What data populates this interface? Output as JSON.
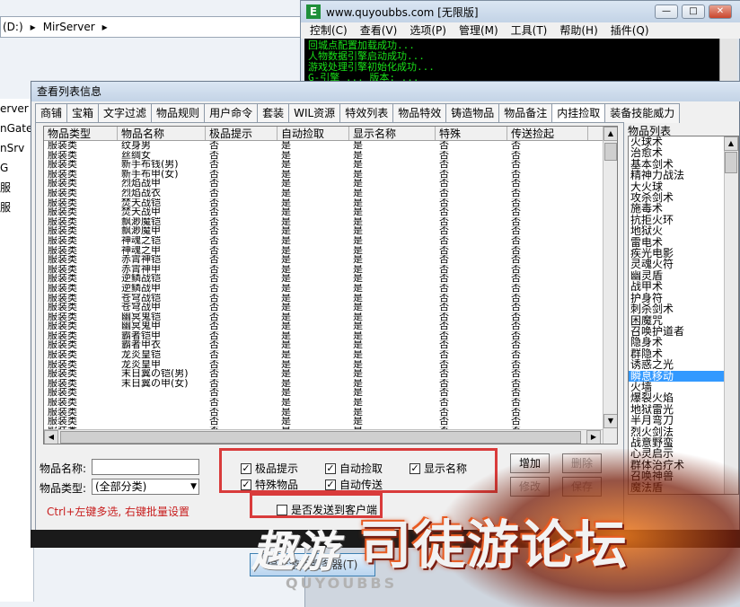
{
  "explorer": {
    "address": [
      "(D:)",
      "MirServer"
    ],
    "left_items": [
      "erver",
      "nGate",
      "nSrv",
      "G",
      "服",
      "服",
      "",
      "",
      "",
      "",
      "",
      "",
      "",
      "",
      "",
      ""
    ]
  },
  "console": {
    "title": "www.quyoubbs.com [无限版]",
    "logo": "E",
    "menu": [
      "控制(C)",
      "查看(V)",
      "选项(P)",
      "管理(M)",
      "工具(T)",
      "帮助(H)",
      "插件(Q)"
    ],
    "log": [
      "回城点配置加载成功...",
      "人物数据引擎启动成功...",
      "游戏处理引擎初始化成功...",
      "G-引擎 ... 版本: ..."
    ]
  },
  "dialog": {
    "title": "查看列表信息",
    "tabs": [
      "商铺",
      "宝箱",
      "文字过滤",
      "物品规则",
      "用户命令",
      "套装",
      "WIL资源",
      "特效列表",
      "物品特效",
      "铸造物品",
      "物品备注",
      "内挂捡取",
      "装备技能威力"
    ],
    "active_tab": 11,
    "columns": [
      "物品类型",
      "物品名称",
      "极品提示",
      "自动捡取",
      "显示名称",
      "特殊",
      "传送捡起"
    ],
    "rows": [
      [
        "服装类",
        "纹身男",
        "否",
        "是",
        "是",
        "否",
        "否"
      ],
      [
        "服装类",
        "丝绸女",
        "否",
        "是",
        "是",
        "否",
        "否"
      ],
      [
        "服装类",
        "新手布钱(男)",
        "否",
        "是",
        "是",
        "否",
        "否"
      ],
      [
        "服装类",
        "新手布甲(女)",
        "否",
        "是",
        "是",
        "否",
        "否"
      ],
      [
        "服装类",
        "烈焰战甲",
        "否",
        "是",
        "是",
        "否",
        "否"
      ],
      [
        "服装类",
        "烈焰战衣",
        "否",
        "是",
        "是",
        "否",
        "否"
      ],
      [
        "服装类",
        "焚天战铠",
        "否",
        "是",
        "是",
        "否",
        "否"
      ],
      [
        "服装类",
        "焚天战甲",
        "否",
        "是",
        "是",
        "否",
        "否"
      ],
      [
        "服装类",
        "飘渺魔铠",
        "否",
        "是",
        "是",
        "否",
        "否"
      ],
      [
        "服装类",
        "飘渺魔甲",
        "否",
        "是",
        "是",
        "否",
        "否"
      ],
      [
        "服装类",
        "神魂之铠",
        "否",
        "是",
        "是",
        "否",
        "否"
      ],
      [
        "服装类",
        "神魂之甲",
        "否",
        "是",
        "是",
        "否",
        "否"
      ],
      [
        "服装类",
        "赤霄神铠",
        "否",
        "是",
        "是",
        "否",
        "否"
      ],
      [
        "服装类",
        "赤霄神甲",
        "否",
        "是",
        "是",
        "否",
        "否"
      ],
      [
        "服装类",
        "逆鳞战铠",
        "否",
        "是",
        "是",
        "否",
        "否"
      ],
      [
        "服装类",
        "逆鳞战甲",
        "否",
        "是",
        "是",
        "否",
        "否"
      ],
      [
        "服装类",
        "苍穹战铠",
        "否",
        "是",
        "是",
        "否",
        "否"
      ],
      [
        "服装类",
        "苍穹战甲",
        "否",
        "是",
        "是",
        "否",
        "否"
      ],
      [
        "服装类",
        "幽冥鬼铠",
        "否",
        "是",
        "是",
        "否",
        "否"
      ],
      [
        "服装类",
        "幽冥鬼甲",
        "否",
        "是",
        "是",
        "否",
        "否"
      ],
      [
        "服装类",
        "霸者铠甲",
        "否",
        "是",
        "是",
        "否",
        "否"
      ],
      [
        "服装类",
        "霸者甲衣",
        "否",
        "是",
        "是",
        "否",
        "否"
      ],
      [
        "服装类",
        "龙炎皇铠",
        "否",
        "是",
        "是",
        "否",
        "否"
      ],
      [
        "服装类",
        "龙炎皇甲",
        "否",
        "是",
        "是",
        "否",
        "否"
      ],
      [
        "服装类",
        "末日翼の铠(男)",
        "否",
        "是",
        "是",
        "否",
        "否"
      ],
      [
        "服装类",
        "末日翼の甲(女)",
        "否",
        "是",
        "是",
        "否",
        "否"
      ],
      [
        "服装类",
        "",
        "否",
        "是",
        "是",
        "否",
        "否"
      ],
      [
        "服装类",
        "",
        "否",
        "是",
        "是",
        "否",
        "否"
      ],
      [
        "服装类",
        "",
        "否",
        "是",
        "是",
        "否",
        "否"
      ],
      [
        "服装类",
        "",
        "否",
        "是",
        "是",
        "否",
        "否"
      ],
      [
        "服装类",
        "",
        "否",
        "是",
        "是",
        "否",
        "否"
      ]
    ],
    "form": {
      "name_label": "物品名称:",
      "name_value": "",
      "type_label": "物品类型:",
      "type_value": "(全部分类)",
      "hint": "Ctrl+左键多选, 右键批量设置",
      "checks": [
        {
          "label": "极品提示",
          "checked": true
        },
        {
          "label": "自动捡取",
          "checked": true
        },
        {
          "label": "显示名称",
          "checked": true
        },
        {
          "label": "特殊物品",
          "checked": true
        },
        {
          "label": "自动传送",
          "checked": true
        }
      ],
      "send_client": {
        "label": "是否发送到客户端",
        "checked": false
      },
      "buttons": {
        "add": "增加",
        "delete": "删除",
        "modify": "修改",
        "save": "保存"
      }
    },
    "right_list_label": "物品列表",
    "right_list": [
      "火球术",
      "治愈术",
      "基本剑术",
      "精神力战法",
      "大火球",
      "攻杀剑术",
      "施毒术",
      "抗拒火环",
      "地狱火",
      "雷电术",
      "疾光电影",
      "灵魂火符",
      "幽灵盾",
      "战甲术",
      "护身符",
      "刺杀剑术",
      "困魔咒",
      "召唤护道者",
      "隐身术",
      "群隐术",
      "诱惑之光",
      "瞬息移动",
      "火墙",
      "爆裂火焰",
      "地狱雷光",
      "半月弯刀",
      "烈火剑法",
      "战意野蛮",
      "心灵启示",
      "群体治疗术",
      "召唤神兽",
      "魔法盾"
    ],
    "right_list_selected": 21,
    "big_button": "停止游戏服务器(T)"
  },
  "watermark": {
    "cn1": "趣游",
    "cn2": "司徒游论坛",
    "en": "QUYOUBBS"
  }
}
